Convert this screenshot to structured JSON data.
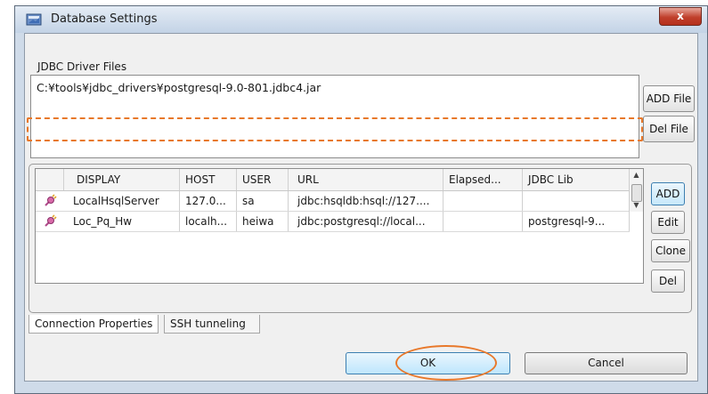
{
  "window": {
    "title": "Database Settings",
    "close_label": "x"
  },
  "drivers": {
    "section_label": "JDBC Driver Files",
    "files": [
      "C:¥tools¥jdbc_drivers¥postgresql-9.0-801.jdbc4.jar"
    ],
    "add_file_label": "ADD File",
    "del_file_label": "Del File"
  },
  "connections": {
    "columns": [
      "DISPLAY",
      "HOST",
      "USER",
      "URL",
      "Elapsed...",
      "JDBC Lib"
    ],
    "rows": [
      {
        "display": "LocalHsqlServer",
        "host": "127.0...",
        "user": "sa",
        "url": "jdbc:hsqldb:hsql://127....",
        "elapsed": "",
        "jdbc_lib": ""
      },
      {
        "display": "Loc_Pq_Hw",
        "host": "localh...",
        "user": "heiwa",
        "url": "jdbc:postgresql://local...",
        "elapsed": "",
        "jdbc_lib": "postgresql-9..."
      }
    ],
    "add_label": "ADD",
    "edit_label": "Edit",
    "clone_label": "Clone",
    "del_label": "Del",
    "selected_row": 1
  },
  "tabs": [
    "Connection Properties",
    "SSH tunneling"
  ],
  "active_tab": 0,
  "footer": {
    "ok_label": "OK",
    "cancel_label": "Cancel"
  },
  "icons": {
    "window_icon": "database-window-icon",
    "row_icon": "connection-plug-icon"
  },
  "colors": {
    "annotation": "#e8782a",
    "titlebar": "#c3d3e6",
    "close": "#c0402c"
  }
}
